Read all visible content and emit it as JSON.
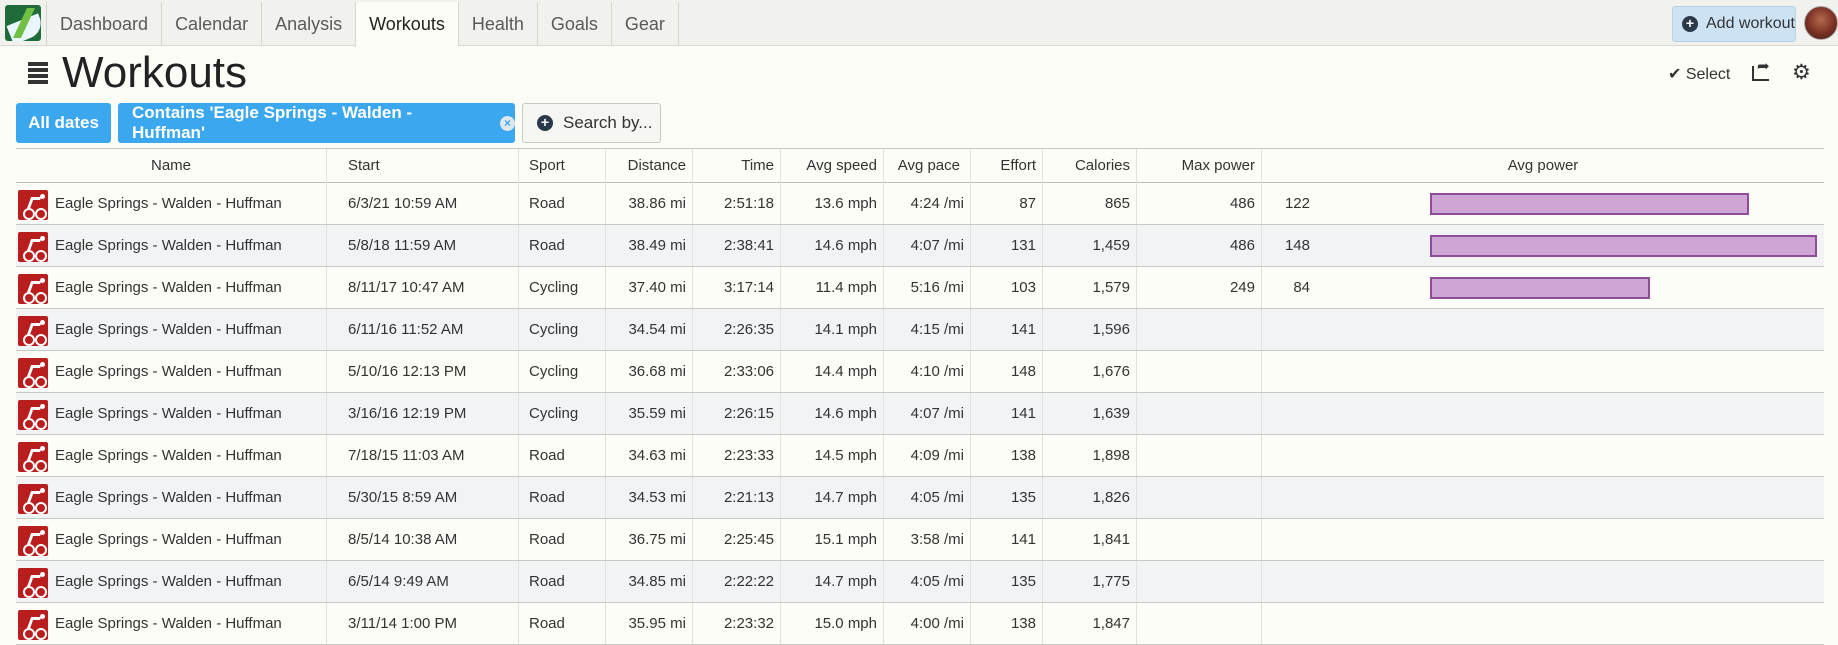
{
  "nav": {
    "tabs": [
      "Dashboard",
      "Calendar",
      "Analysis",
      "Workouts",
      "Health",
      "Goals",
      "Gear"
    ],
    "active_tab": "Workouts",
    "add_workout_label": "Add workout"
  },
  "page": {
    "title": "Workouts",
    "select_label": "✔ Select"
  },
  "filters": {
    "dates_label": "All dates",
    "contains_label": "Contains 'Eagle Springs - Walden - Huffman'",
    "search_label": "Search by..."
  },
  "table": {
    "columns": {
      "name": "Name",
      "start": "Start",
      "sport": "Sport",
      "distance": "Distance",
      "time": "Time",
      "avg_speed": "Avg speed",
      "avg_pace": "Avg pace",
      "effort": "Effort",
      "calories": "Calories",
      "max_power": "Max power",
      "avg_power": "Avg power"
    },
    "avg_power_bar_max": 148,
    "bar_color": "#cfa5d3",
    "rows": [
      {
        "name": "Eagle Springs - Walden - Huffman",
        "start": "6/3/21 10:59 AM",
        "sport": "Road",
        "distance": "38.86 mi",
        "time": "2:51:18",
        "avg_speed": "13.6 mph",
        "avg_pace": "4:24 /mi",
        "effort": "87",
        "calories": "865",
        "max_power": "486",
        "avg_power": "122"
      },
      {
        "name": "Eagle Springs - Walden - Huffman",
        "start": "5/8/18 11:59 AM",
        "sport": "Road",
        "distance": "38.49 mi",
        "time": "2:38:41",
        "avg_speed": "14.6 mph",
        "avg_pace": "4:07 /mi",
        "effort": "131",
        "calories": "1,459",
        "max_power": "486",
        "avg_power": "148"
      },
      {
        "name": "Eagle Springs - Walden - Huffman",
        "start": "8/11/17 10:47 AM",
        "sport": "Cycling",
        "distance": "37.40 mi",
        "time": "3:17:14",
        "avg_speed": "11.4 mph",
        "avg_pace": "5:16 /mi",
        "effort": "103",
        "calories": "1,579",
        "max_power": "249",
        "avg_power": "84"
      },
      {
        "name": "Eagle Springs - Walden - Huffman",
        "start": "6/11/16 11:52 AM",
        "sport": "Cycling",
        "distance": "34.54 mi",
        "time": "2:26:35",
        "avg_speed": "14.1 mph",
        "avg_pace": "4:15 /mi",
        "effort": "141",
        "calories": "1,596",
        "max_power": "",
        "avg_power": ""
      },
      {
        "name": "Eagle Springs - Walden - Huffman",
        "start": "5/10/16 12:13 PM",
        "sport": "Cycling",
        "distance": "36.68 mi",
        "time": "2:33:06",
        "avg_speed": "14.4 mph",
        "avg_pace": "4:10 /mi",
        "effort": "148",
        "calories": "1,676",
        "max_power": "",
        "avg_power": ""
      },
      {
        "name": "Eagle Springs - Walden - Huffman",
        "start": "3/16/16 12:19 PM",
        "sport": "Cycling",
        "distance": "35.59 mi",
        "time": "2:26:15",
        "avg_speed": "14.6 mph",
        "avg_pace": "4:07 /mi",
        "effort": "141",
        "calories": "1,639",
        "max_power": "",
        "avg_power": ""
      },
      {
        "name": "Eagle Springs - Walden - Huffman",
        "start": "7/18/15 11:03 AM",
        "sport": "Road",
        "distance": "34.63 mi",
        "time": "2:23:33",
        "avg_speed": "14.5 mph",
        "avg_pace": "4:09 /mi",
        "effort": "138",
        "calories": "1,898",
        "max_power": "",
        "avg_power": ""
      },
      {
        "name": "Eagle Springs - Walden - Huffman",
        "start": "5/30/15 8:59 AM",
        "sport": "Road",
        "distance": "34.53 mi",
        "time": "2:21:13",
        "avg_speed": "14.7 mph",
        "avg_pace": "4:05 /mi",
        "effort": "135",
        "calories": "1,826",
        "max_power": "",
        "avg_power": ""
      },
      {
        "name": "Eagle Springs - Walden - Huffman",
        "start": "8/5/14 10:38 AM",
        "sport": "Road",
        "distance": "36.75 mi",
        "time": "2:25:45",
        "avg_speed": "15.1 mph",
        "avg_pace": "3:58 /mi",
        "effort": "141",
        "calories": "1,841",
        "max_power": "",
        "avg_power": ""
      },
      {
        "name": "Eagle Springs - Walden - Huffman",
        "start": "6/5/14 9:49 AM",
        "sport": "Road",
        "distance": "34.85 mi",
        "time": "2:22:22",
        "avg_speed": "14.7 mph",
        "avg_pace": "4:05 /mi",
        "effort": "135",
        "calories": "1,775",
        "max_power": "",
        "avg_power": ""
      },
      {
        "name": "Eagle Springs - Walden - Huffman",
        "start": "3/11/14 1:00 PM",
        "sport": "Road",
        "distance": "35.95 mi",
        "time": "2:23:32",
        "avg_speed": "15.0 mph",
        "avg_pace": "4:00 /mi",
        "effort": "138",
        "calories": "1,847",
        "max_power": "",
        "avg_power": ""
      }
    ]
  }
}
